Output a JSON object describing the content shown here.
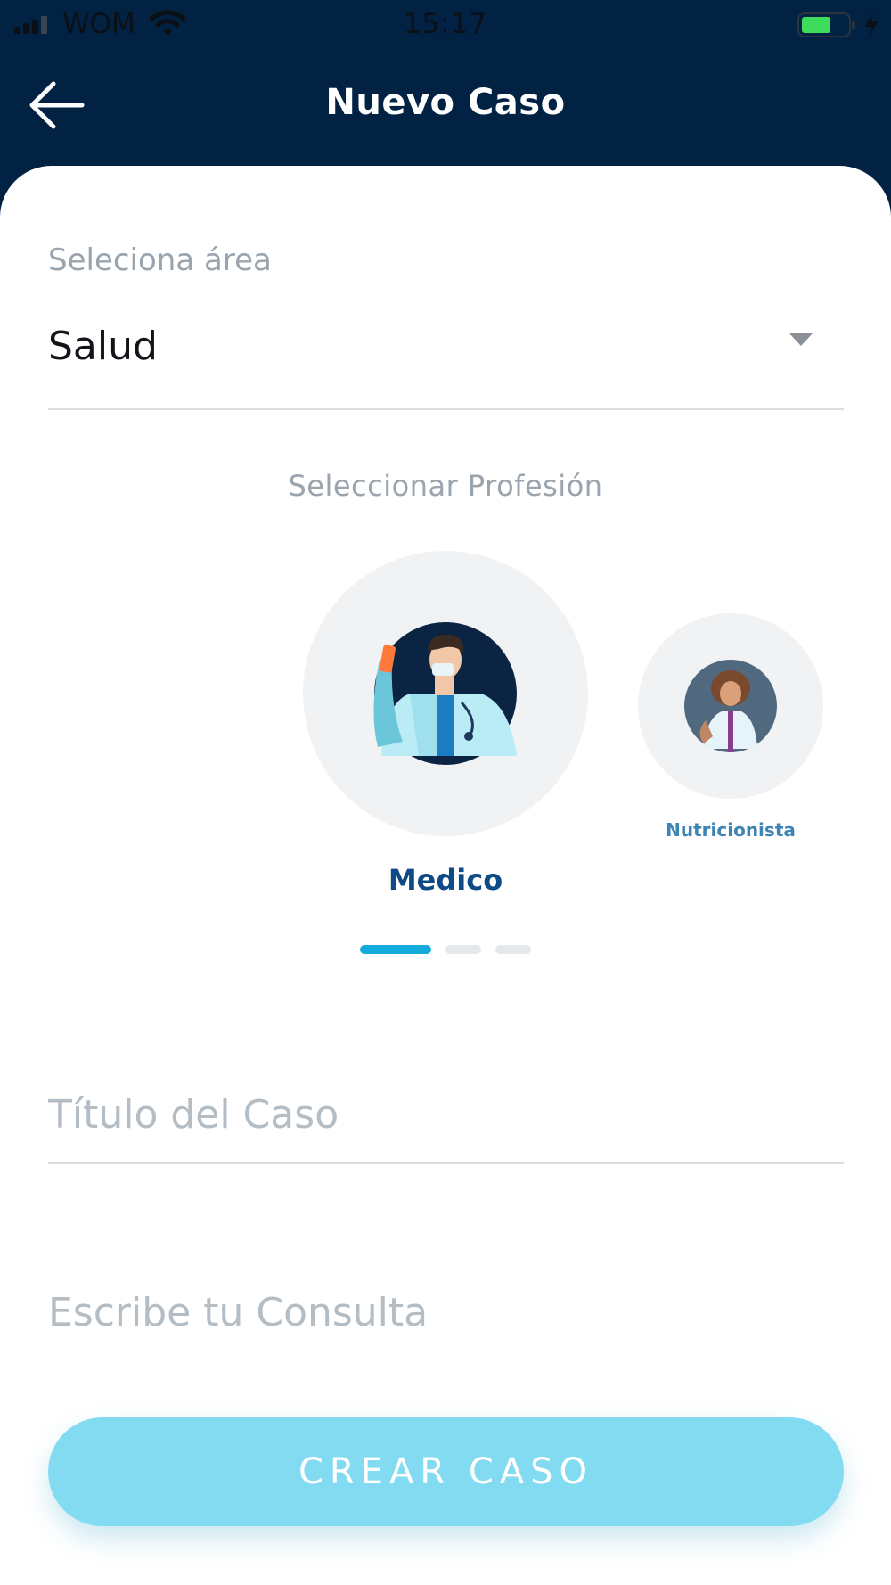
{
  "status_bar": {
    "carrier": "WOM",
    "time": "15:17",
    "icons": [
      "signal-icon",
      "wifi-icon",
      "battery-icon",
      "charging-icon"
    ]
  },
  "header": {
    "title": "Nuevo Caso",
    "back_icon": "arrow-left-icon",
    "background_color": "#022244"
  },
  "area_select": {
    "label": "Seleciona área",
    "value": "Salud",
    "icon": "caret-down-icon"
  },
  "profession": {
    "label": "Seleccionar Profesión",
    "items": [
      {
        "name": "Medico",
        "selected": true
      },
      {
        "name": "Nutricionista",
        "selected": false
      }
    ],
    "pager": {
      "total": 3,
      "active_index": 0
    }
  },
  "case_title": {
    "placeholder": "Título del Caso"
  },
  "consultation": {
    "placeholder": "Escribe tu Consulta"
  },
  "actions": {
    "create_label": "CREAR CASO"
  },
  "colors": {
    "accent": "#12ABDB",
    "button": "#82DBF0",
    "selected_name": "#0D4A86",
    "unselected_name": "#3E85B6",
    "muted_text": "#9AA4AE"
  }
}
